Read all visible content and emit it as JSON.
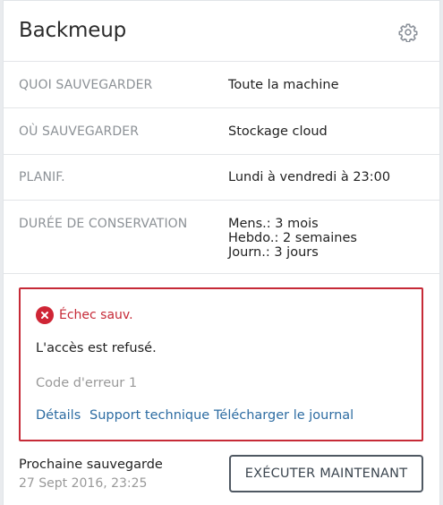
{
  "header": {
    "title": "Backmeup",
    "settings_icon": "gear-icon"
  },
  "rows": [
    {
      "label": "QUOI SAUVEGARDER",
      "value": "Toute la machine"
    },
    {
      "label": "OÙ SAUVEGARDER",
      "value": "Stockage cloud"
    },
    {
      "label": "PLANIF.",
      "value": "Lundi à vendredi à 23:00"
    },
    {
      "label": "DURÉE DE CONSERVATION",
      "values": [
        "Mens.: 3 mois",
        "Hebdo.: 2 semaines",
        "Journ.: 3 jours"
      ]
    }
  ],
  "error": {
    "title": "Échec sauv.",
    "message": "L'accès est refusé.",
    "code": "Code d'erreur 1",
    "links": {
      "details": "Détails",
      "support": "Support technique",
      "download_log": "Télécharger le journal"
    },
    "color": "#c62a37"
  },
  "footer": {
    "next_label": "Prochaine sauvegarde",
    "next_date": "27 Sept 2016, 23:25",
    "run_button": "EXÉCUTER MAINTENANT"
  }
}
